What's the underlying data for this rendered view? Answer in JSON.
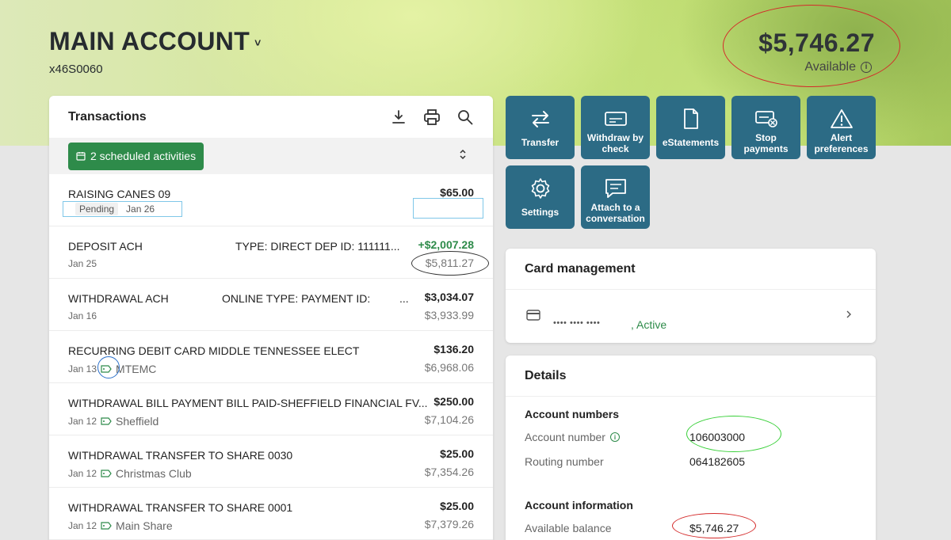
{
  "header": {
    "account_title": "MAIN ACCOUNT",
    "account_caret": "˅",
    "account_number": "x46S0060",
    "balance": "$5,746.27",
    "balance_label": "Available"
  },
  "transactions": {
    "title": "Transactions",
    "scheduled_label": "2 scheduled activities",
    "rows": [
      {
        "name": "RAISING CANES 09",
        "desc": "",
        "date": "Jan 26",
        "status": "Pending",
        "memo": "",
        "amount": "$65.00",
        "running": ""
      },
      {
        "name": "DEPOSIT ACH",
        "desc": "TYPE: DIRECT DEP ID:  111111...",
        "date": "Jan 25",
        "memo": "",
        "amount": "+$2,007.28",
        "running": "$5,811.27"
      },
      {
        "name": "WITHDRAWAL ACH",
        "desc": "ONLINE TYPE: PAYMENT ID:",
        "desc_ellipsis": "...",
        "date": "Jan 16",
        "memo": "",
        "amount": "$3,034.07",
        "running": "$3,933.99"
      },
      {
        "name": "RECURRING DEBIT CARD MIDDLE TENNESSEE ELECT",
        "desc": "",
        "date": "Jan 13",
        "memo": "MTEMC",
        "amount": "$136.20",
        "running": "$6,968.06"
      },
      {
        "name": "WITHDRAWAL BILL PAYMENT BILL PAID-SHEFFIELD FINANCIAL FV...",
        "desc": "",
        "date": "Jan 12",
        "memo": "Sheffield",
        "amount": "$250.00",
        "running": "$7,104.26"
      },
      {
        "name": "WITHDRAWAL TRANSFER TO SHARE 0030",
        "desc": "",
        "date": "Jan 12",
        "memo": "Christmas Club",
        "amount": "$25.00",
        "running": "$7,354.26"
      },
      {
        "name": "WITHDRAWAL TRANSFER TO SHARE 0001",
        "desc": "",
        "date": "Jan 12",
        "memo": "Main Share",
        "amount": "$25.00",
        "running": "$7,379.26"
      }
    ]
  },
  "actions": [
    {
      "label": "Transfer",
      "icon": "transfer-icon"
    },
    {
      "label": "Withdraw by check",
      "icon": "check-icon"
    },
    {
      "label": "eStatements",
      "icon": "document-icon"
    },
    {
      "label": "Stop payments",
      "icon": "stop-payment-icon"
    },
    {
      "label": "Alert preferences",
      "icon": "alert-icon"
    },
    {
      "label": "Settings",
      "icon": "gear-icon"
    },
    {
      "label": "Attach to a conversation",
      "icon": "chat-icon"
    }
  ],
  "card_management": {
    "title": "Card management",
    "masked_number": "•••• •••• ••••",
    "status": ", Active"
  },
  "details": {
    "title": "Details",
    "account_numbers_heading": "Account numbers",
    "account_number_label": "Account number",
    "account_number_value": "106003000",
    "routing_number_label": "Routing number",
    "routing_number_value": "064182605",
    "account_info_heading": "Account information",
    "available_balance_label": "Available balance",
    "available_balance_value": "$5,746.27"
  },
  "colors": {
    "tile": "#2c6b85",
    "green": "#2e8b4a"
  }
}
